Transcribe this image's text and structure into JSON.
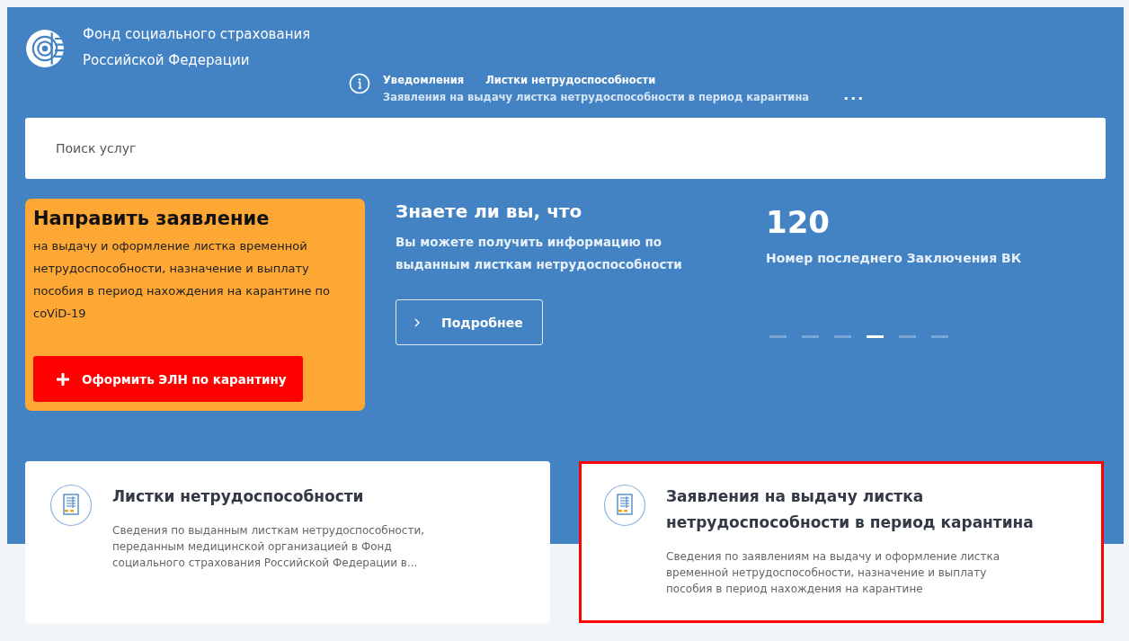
{
  "header": {
    "org_name_line1": "Фонд социального страхования",
    "org_name_line2": "Российской Федерации"
  },
  "nav": {
    "links": [
      {
        "label": "Уведомления"
      },
      {
        "label": "Листки нетрудоспособности"
      }
    ],
    "sublinks": [
      {
        "label": "Заявления на выдачу листка нетрудоспособности в период карантина"
      }
    ],
    "more": "..."
  },
  "search": {
    "placeholder": "Поиск услуг"
  },
  "promo": {
    "title": "Направить заявление",
    "text": "на выдачу и оформление листка временной нетрудоспособности, назначение и выплату пособия в период нахождения на карантине по coViD-19",
    "button": "Оформить ЭЛН по карантину"
  },
  "tip": {
    "title": "Знаете ли вы, что",
    "text": "Вы можете получить информацию по выданным листкам нетрудоспособности",
    "button": "Подробнее"
  },
  "stat": {
    "value": "120",
    "label": "Номер последнего Заключения ВК",
    "slides": [
      {
        "selected": false
      },
      {
        "selected": false
      },
      {
        "selected": false
      },
      {
        "selected": true
      },
      {
        "selected": false
      },
      {
        "selected": false
      }
    ]
  },
  "cards": [
    {
      "title": "Листки нетрудоспособности",
      "text": "Сведения по выданным листкам нетрудоспособности, переданным медицинской организацией в Фонд социального страхования Российской Федерации в...",
      "selected": false
    },
    {
      "title": "Заявления на выдачу листка нетрудоспособности в период карантина",
      "text": "Сведения по заявлениям на выдачу и оформление листка временной нетрудоспособности, назначение и выплату пособия в период нахождения на карантине",
      "selected": true
    }
  ]
}
